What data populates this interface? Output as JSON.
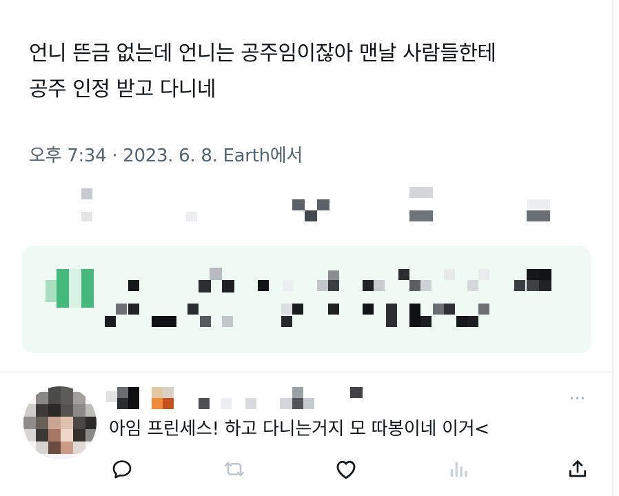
{
  "tweet": {
    "line1": "언니 뜬금 없는데 언니는 공주임이잖아 맨날 사람들한테",
    "line2": "공주 인정 받고 다니네",
    "meta": "오후 7:34 · 2023. 6. 8. Earth에서"
  },
  "reply": {
    "text": "아임 프린세스! 하고 다니는거지 모 따봉이네 이거<",
    "more_label": "···"
  },
  "actions": [
    {
      "name": "reply-icon"
    },
    {
      "name": "retweet-icon"
    },
    {
      "name": "like-icon"
    },
    {
      "name": "views-icon"
    },
    {
      "name": "share-icon"
    }
  ],
  "colors": {
    "text": "#0f1419",
    "meta": "#536471",
    "banner_bg": "#effaf4",
    "banner_accent": "#45b97c",
    "icon": "#0f1419",
    "icon_muted": "#bcc5cd"
  }
}
